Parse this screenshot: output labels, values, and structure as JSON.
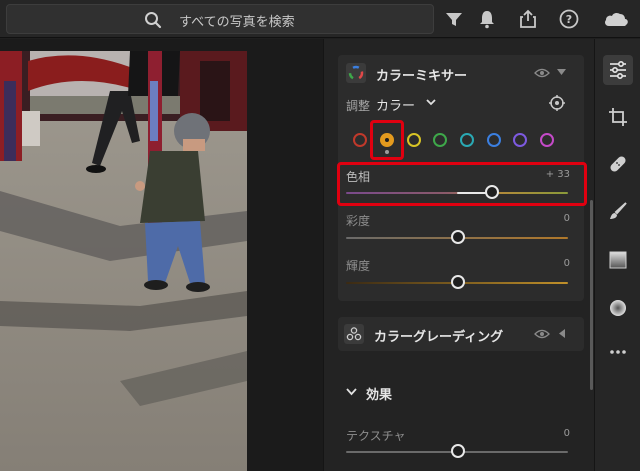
{
  "search": {
    "placeholder": "すべての写真を検索"
  },
  "toolbar": {
    "icons": [
      "filter-icon",
      "bell-icon",
      "share-icon",
      "help-icon",
      "cloud-icon"
    ]
  },
  "color_mixer": {
    "title": "カラーミキサー",
    "adjust_label": "調整",
    "adjust_value": "カラー",
    "swatches": [
      {
        "name": "red",
        "color": "#c0392b"
      },
      {
        "name": "orange",
        "color": "#e39a1e",
        "selected": true
      },
      {
        "name": "yellow",
        "color": "#d8c425"
      },
      {
        "name": "green",
        "color": "#3ea84a"
      },
      {
        "name": "aqua",
        "color": "#2aa9b4"
      },
      {
        "name": "blue",
        "color": "#3b7fe0"
      },
      {
        "name": "purple",
        "color": "#7d5ae0"
      },
      {
        "name": "magenta",
        "color": "#c44ac8"
      }
    ],
    "sliders": [
      {
        "label": "色相",
        "value": "+ 33",
        "level": 33
      },
      {
        "label": "彩度",
        "value": "0",
        "level": 0
      },
      {
        "label": "輝度",
        "value": "0",
        "level": 0
      }
    ]
  },
  "color_grading": {
    "title": "カラーグレーディング"
  },
  "effects": {
    "title": "効果",
    "sliders": [
      {
        "label": "テクスチャ",
        "value": "0",
        "level": 0
      }
    ]
  },
  "rail": {
    "icons": [
      "sliders-icon",
      "crop-icon",
      "healing-icon",
      "brush-icon",
      "gradient-icon",
      "radial-icon",
      "more-icon"
    ]
  },
  "colors": {
    "highlight": "#e00010",
    "panel": "#2c2c2c",
    "accent": "#e39a1e"
  }
}
